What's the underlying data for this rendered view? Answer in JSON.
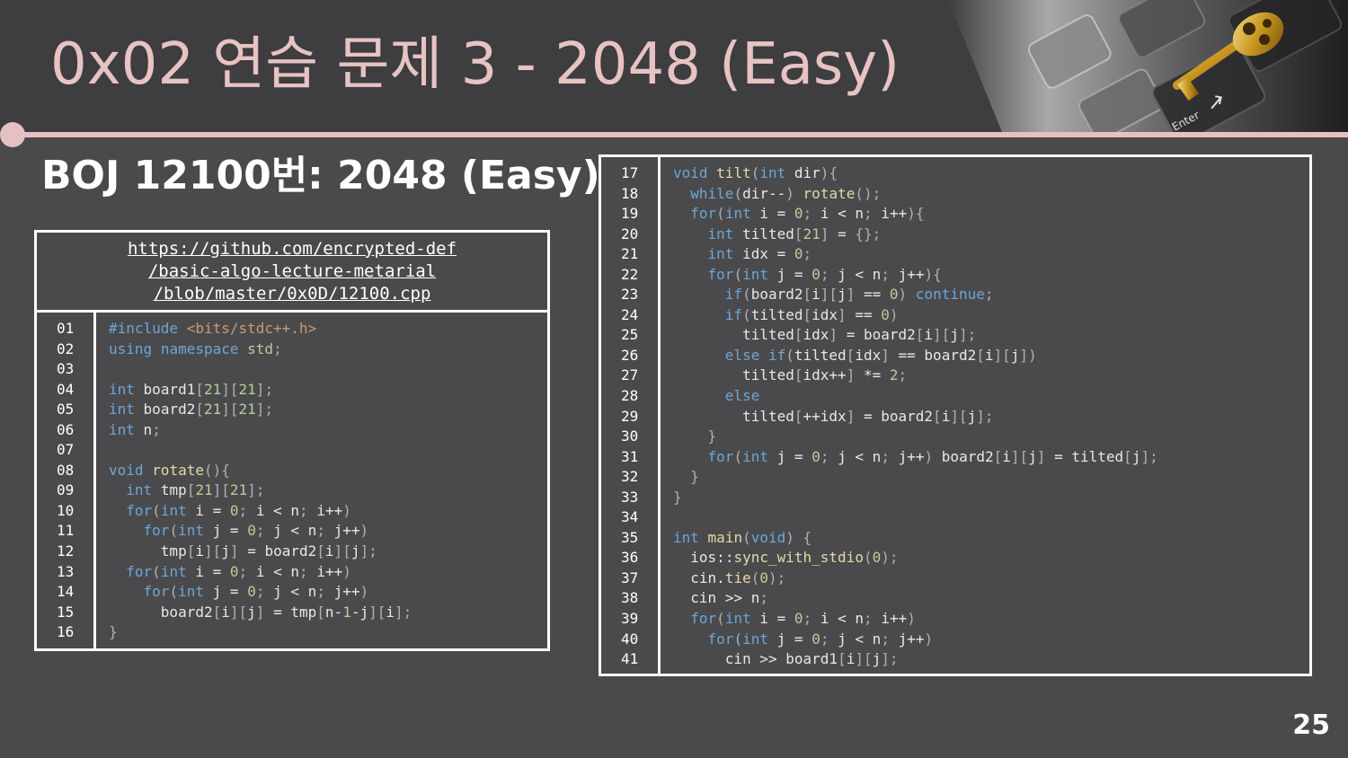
{
  "slide": {
    "title": "0x02  연습 문제 3 - 2048 (Easy)",
    "subtitle": "BOJ 12100번: 2048 (Easy)",
    "page_number": "25"
  },
  "link": {
    "lines": [
      "https://github.com/encrypted-def",
      "/basic-algo-lecture-metarial",
      "/blob/master/0x0D/12100.cpp"
    ]
  },
  "code_left": {
    "line_numbers": [
      "01",
      "02",
      "03",
      "04",
      "05",
      "06",
      "07",
      "08",
      "09",
      "10",
      "11",
      "12",
      "13",
      "14",
      "15",
      "16"
    ],
    "lines": [
      "#include <bits/stdc++.h>",
      "using namespace std;",
      "",
      "int board1[21][21];",
      "int board2[21][21];",
      "int n;",
      "",
      "void rotate(){",
      "  int tmp[21][21];",
      "  for(int i = 0; i < n; i++)",
      "    for(int j = 0; j < n; j++)",
      "      tmp[i][j] = board2[i][j];",
      "  for(int i = 0; i < n; i++)",
      "    for(int j = 0; j < n; j++)",
      "      board2[i][j] = tmp[n-1-j][i];",
      "}"
    ]
  },
  "code_right": {
    "line_numbers": [
      "17",
      "18",
      "19",
      "20",
      "21",
      "22",
      "23",
      "24",
      "25",
      "26",
      "27",
      "28",
      "29",
      "30",
      "31",
      "32",
      "33",
      "34",
      "35",
      "36",
      "37",
      "38",
      "39",
      "40",
      "41"
    ],
    "lines": [
      "void tilt(int dir){",
      "  while(dir--) rotate();",
      "  for(int i = 0; i < n; i++){",
      "    int tilted[21] = {};",
      "    int idx = 0;",
      "    for(int j = 0; j < n; j++){",
      "      if(board2[i][j] == 0) continue;",
      "      if(tilted[idx] == 0)",
      "        tilted[idx] = board2[i][j];",
      "      else if(tilted[idx] == board2[i][j])",
      "        tilted[idx++] *= 2;",
      "      else",
      "        tilted[++idx] = board2[i][j];",
      "    }",
      "    for(int j = 0; j < n; j++) board2[i][j] = tilted[j];",
      "  }",
      "}",
      "",
      "int main(void) {",
      "  ios::sync_with_stdio(0);",
      "  cin.tie(0);",
      "  cin >> n;",
      "  for(int i = 0; i < n; i++)",
      "    for(int j = 0; j < n; j++)",
      "      cin >> board1[i][j];"
    ]
  },
  "colors": {
    "accent": "#e5c1c1",
    "background": "#4a4a4c",
    "keyword": "#6ea6d6",
    "function": "#e4d9a6",
    "number": "#b8cf9a"
  },
  "icons": {
    "header_image": "keyboard-with-golden-key-image"
  }
}
